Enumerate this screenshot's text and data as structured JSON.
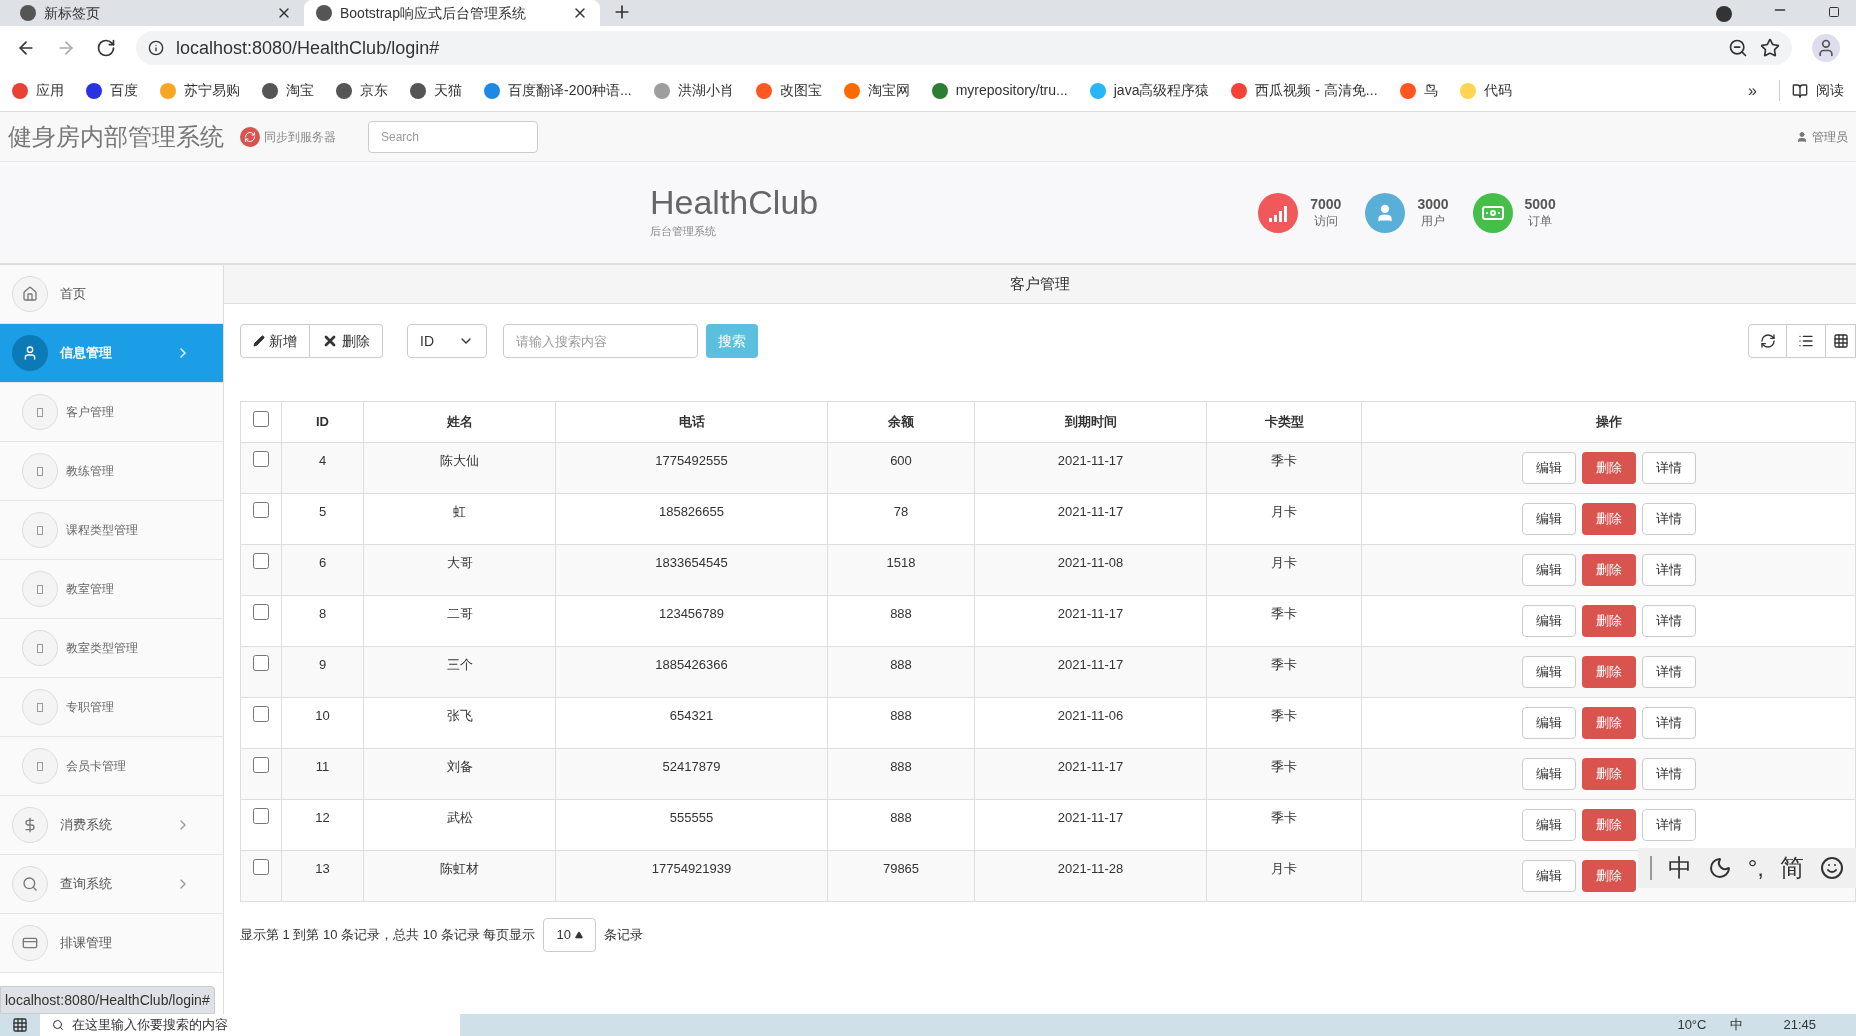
{
  "browser": {
    "tabs": [
      {
        "title": "新标签页",
        "selected": false
      },
      {
        "title": "Bootstrap响应式后台管理系统",
        "selected": true
      }
    ],
    "url": "localhost:8080/HealthClub/login#",
    "bookmarks": [
      {
        "label": "应用",
        "color": "#e94235"
      },
      {
        "label": "百度",
        "color": "#2932e1"
      },
      {
        "label": "苏宁易购",
        "color": "#f5a623"
      },
      {
        "label": "淘宝",
        "color": "#555555"
      },
      {
        "label": "京东",
        "color": "#555555"
      },
      {
        "label": "天猫",
        "color": "#555555"
      },
      {
        "label": "百度翻译-200种语...",
        "color": "#1e88e5"
      },
      {
        "label": "洪湖小肖",
        "color": "#9e9e9e"
      },
      {
        "label": "改图宝",
        "color": "#ff5722"
      },
      {
        "label": "淘宝网",
        "color": "#ff6a00"
      },
      {
        "label": "myrepository/tru...",
        "color": "#2e7d32"
      },
      {
        "label": "java高级程序猿",
        "color": "#29b6f6"
      },
      {
        "label": "西瓜视频 - 高清免...",
        "color": "#f44336"
      },
      {
        "label": "鸟",
        "color": "#ff5722"
      },
      {
        "label": "代码",
        "color": "#ffd54f"
      }
    ],
    "overflow": "»",
    "reading_list": "阅读"
  },
  "navbar": {
    "brand": "健身房内部管理系统",
    "sync": "同步到服务器",
    "search_placeholder": "Search",
    "user": "管理员"
  },
  "header": {
    "logo": "HealthClub",
    "subtitle": "后台管理系统",
    "stats": [
      {
        "kind": "signal",
        "value": "7000",
        "label": "访问",
        "color": "#f0585a"
      },
      {
        "kind": "user",
        "value": "3000",
        "label": "用户",
        "color": "#5aafd9"
      },
      {
        "kind": "money",
        "value": "5000",
        "label": "订单",
        "color": "#43bf4a"
      }
    ]
  },
  "sidebar": [
    {
      "label": "首页",
      "kind": "home",
      "selected": false
    },
    {
      "label": "信息管理",
      "kind": "user",
      "selected": true,
      "expanded": true,
      "children": [
        {
          "label": "客户管理"
        },
        {
          "label": "教练管理"
        },
        {
          "label": "课程类型管理"
        },
        {
          "label": "教室管理"
        },
        {
          "label": "教室类型管理"
        },
        {
          "label": "专职管理"
        },
        {
          "label": "会员卡管理"
        }
      ]
    },
    {
      "label": "消费系统",
      "kind": "dollar",
      "selected": false,
      "expanded": false
    },
    {
      "label": "查询系统",
      "kind": "search",
      "selected": false,
      "expanded": false
    },
    {
      "label": "排课管理",
      "kind": "card",
      "selected": false
    }
  ],
  "panel": {
    "title": "客户管理",
    "add": "新增",
    "delete": "删除",
    "field_select": "ID",
    "search_placeholder": "请输入搜索内容",
    "search_button": "搜索"
  },
  "table": {
    "select_all_checked": false,
    "columns": [
      "ID",
      "姓名",
      "电话",
      "余额",
      "到期时间",
      "卡类型",
      "操作"
    ],
    "rows": [
      {
        "checked": false,
        "cells": [
          "4",
          "陈大仙",
          "1775492555",
          "600",
          "2021-11-17",
          "季卡"
        ],
        "actions": [
          {
            "label": "编辑",
            "kind": "default"
          },
          {
            "label": "删除",
            "kind": "danger"
          },
          {
            "label": "详情",
            "kind": "default"
          }
        ]
      },
      {
        "checked": false,
        "cells": [
          "5",
          "虹",
          "185826655",
          "78",
          "2021-11-17",
          "月卡"
        ],
        "actions": [
          {
            "label": "编辑",
            "kind": "default"
          },
          {
            "label": "删除",
            "kind": "danger"
          },
          {
            "label": "详情",
            "kind": "default"
          }
        ]
      },
      {
        "checked": false,
        "cells": [
          "6",
          "大哥",
          "1833654545",
          "1518",
          "2021-11-08",
          "月卡"
        ],
        "actions": [
          {
            "label": "编辑",
            "kind": "default"
          },
          {
            "label": "删除",
            "kind": "danger"
          },
          {
            "label": "详情",
            "kind": "default"
          }
        ]
      },
      {
        "checked": false,
        "cells": [
          "8",
          "二哥",
          "123456789",
          "888",
          "2021-11-17",
          "季卡"
        ],
        "actions": [
          {
            "label": "编辑",
            "kind": "default"
          },
          {
            "label": "删除",
            "kind": "danger"
          },
          {
            "label": "详情",
            "kind": "default"
          }
        ]
      },
      {
        "checked": false,
        "cells": [
          "9",
          "三个",
          "1885426366",
          "888",
          "2021-11-17",
          "季卡"
        ],
        "actions": [
          {
            "label": "编辑",
            "kind": "default"
          },
          {
            "label": "删除",
            "kind": "danger"
          },
          {
            "label": "详情",
            "kind": "default"
          }
        ]
      },
      {
        "checked": false,
        "cells": [
          "10",
          "张飞",
          "654321",
          "888",
          "2021-11-06",
          "季卡"
        ],
        "actions": [
          {
            "label": "编辑",
            "kind": "default"
          },
          {
            "label": "删除",
            "kind": "danger"
          },
          {
            "label": "详情",
            "kind": "default"
          }
        ]
      },
      {
        "checked": false,
        "cells": [
          "11",
          "刘备",
          "52417879",
          "888",
          "2021-11-17",
          "季卡"
        ],
        "actions": [
          {
            "label": "编辑",
            "kind": "default"
          },
          {
            "label": "删除",
            "kind": "danger"
          },
          {
            "label": "详情",
            "kind": "default"
          }
        ]
      },
      {
        "checked": false,
        "cells": [
          "12",
          "武松",
          "555555",
          "888",
          "2021-11-17",
          "季卡"
        ],
        "actions": [
          {
            "label": "编辑",
            "kind": "default"
          },
          {
            "label": "删除",
            "kind": "danger"
          },
          {
            "label": "详情",
            "kind": "default"
          }
        ]
      },
      {
        "checked": false,
        "cells": [
          "13",
          "陈虹材",
          "17754921939",
          "79865",
          "2021-11-28",
          "月卡"
        ],
        "actions": [
          {
            "label": "编辑",
            "kind": "default"
          },
          {
            "label": "删除",
            "kind": "danger"
          }
        ]
      }
    ]
  },
  "pagination": {
    "summary": "显示第 1 到第 10 条记录，总共 10 条记录 每页显示",
    "page_size": "10",
    "suffix": "条记录"
  },
  "status_url": "localhost:8080/HealthClub/login#",
  "ime": [
    "中",
    "°,",
    "简"
  ],
  "taskbar": {
    "search_placeholder": "在这里输入你要搜索的内容",
    "weather": "10°C",
    "ime": "中",
    "time": "21:45"
  }
}
